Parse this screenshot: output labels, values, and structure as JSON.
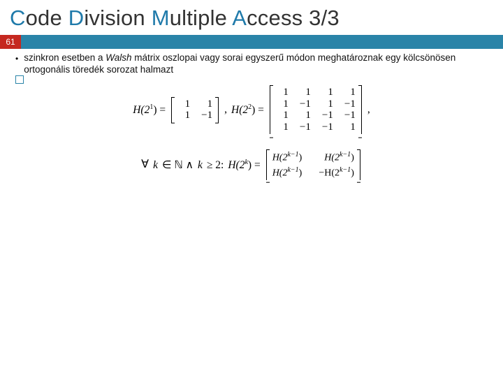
{
  "title": {
    "c": "C",
    "ode": "ode ",
    "d": "D",
    "ivision": "ivision ",
    "m": "M",
    "ultiple": "ultiple ",
    "a": "A",
    "ccess": "ccess 3/3"
  },
  "slide_number": "61",
  "bullet": {
    "pre": "szinkron esetben a ",
    "walsh": "Walsh",
    "post": " mátrix oszlopai vagy sorai egyszerű módon meghatároznak egy kölcsönösen ortogonális töredék sorozat halmazt"
  },
  "math": {
    "H21_lhs": "H(2",
    "H21_exp": "1",
    "H21_rhs": ") = ",
    "m2": [
      "1",
      "1",
      "1",
      "−1"
    ],
    "sep": ", ",
    "H22_lhs": "H(2",
    "H22_exp": "2",
    "H22_rhs": ") = ",
    "m4": [
      "1",
      "1",
      "1",
      "1",
      "1",
      "−1",
      "1",
      "−1",
      "1",
      "1",
      "−1",
      "−1",
      "1",
      "−1",
      "−1",
      "1"
    ],
    "tail": ",",
    "forall_pre": "∀",
    "kvar": "k",
    "in": " ∈ ℕ ∧ ",
    "kge": " ≥ 2: ",
    "Hk_lhs": "H(2",
    "Hk_exp": "k",
    "Hk_rhs": ") = ",
    "rec": {
      "a": "H(2",
      "ae": "k−1",
      "ar": ")",
      "b": "H(2",
      "be": "k−1",
      "br": ")",
      "c": "H(2",
      "ce": "k−1",
      "cr": ")",
      "d": "−H(2",
      "de": "k−1",
      "dr": ")"
    }
  }
}
